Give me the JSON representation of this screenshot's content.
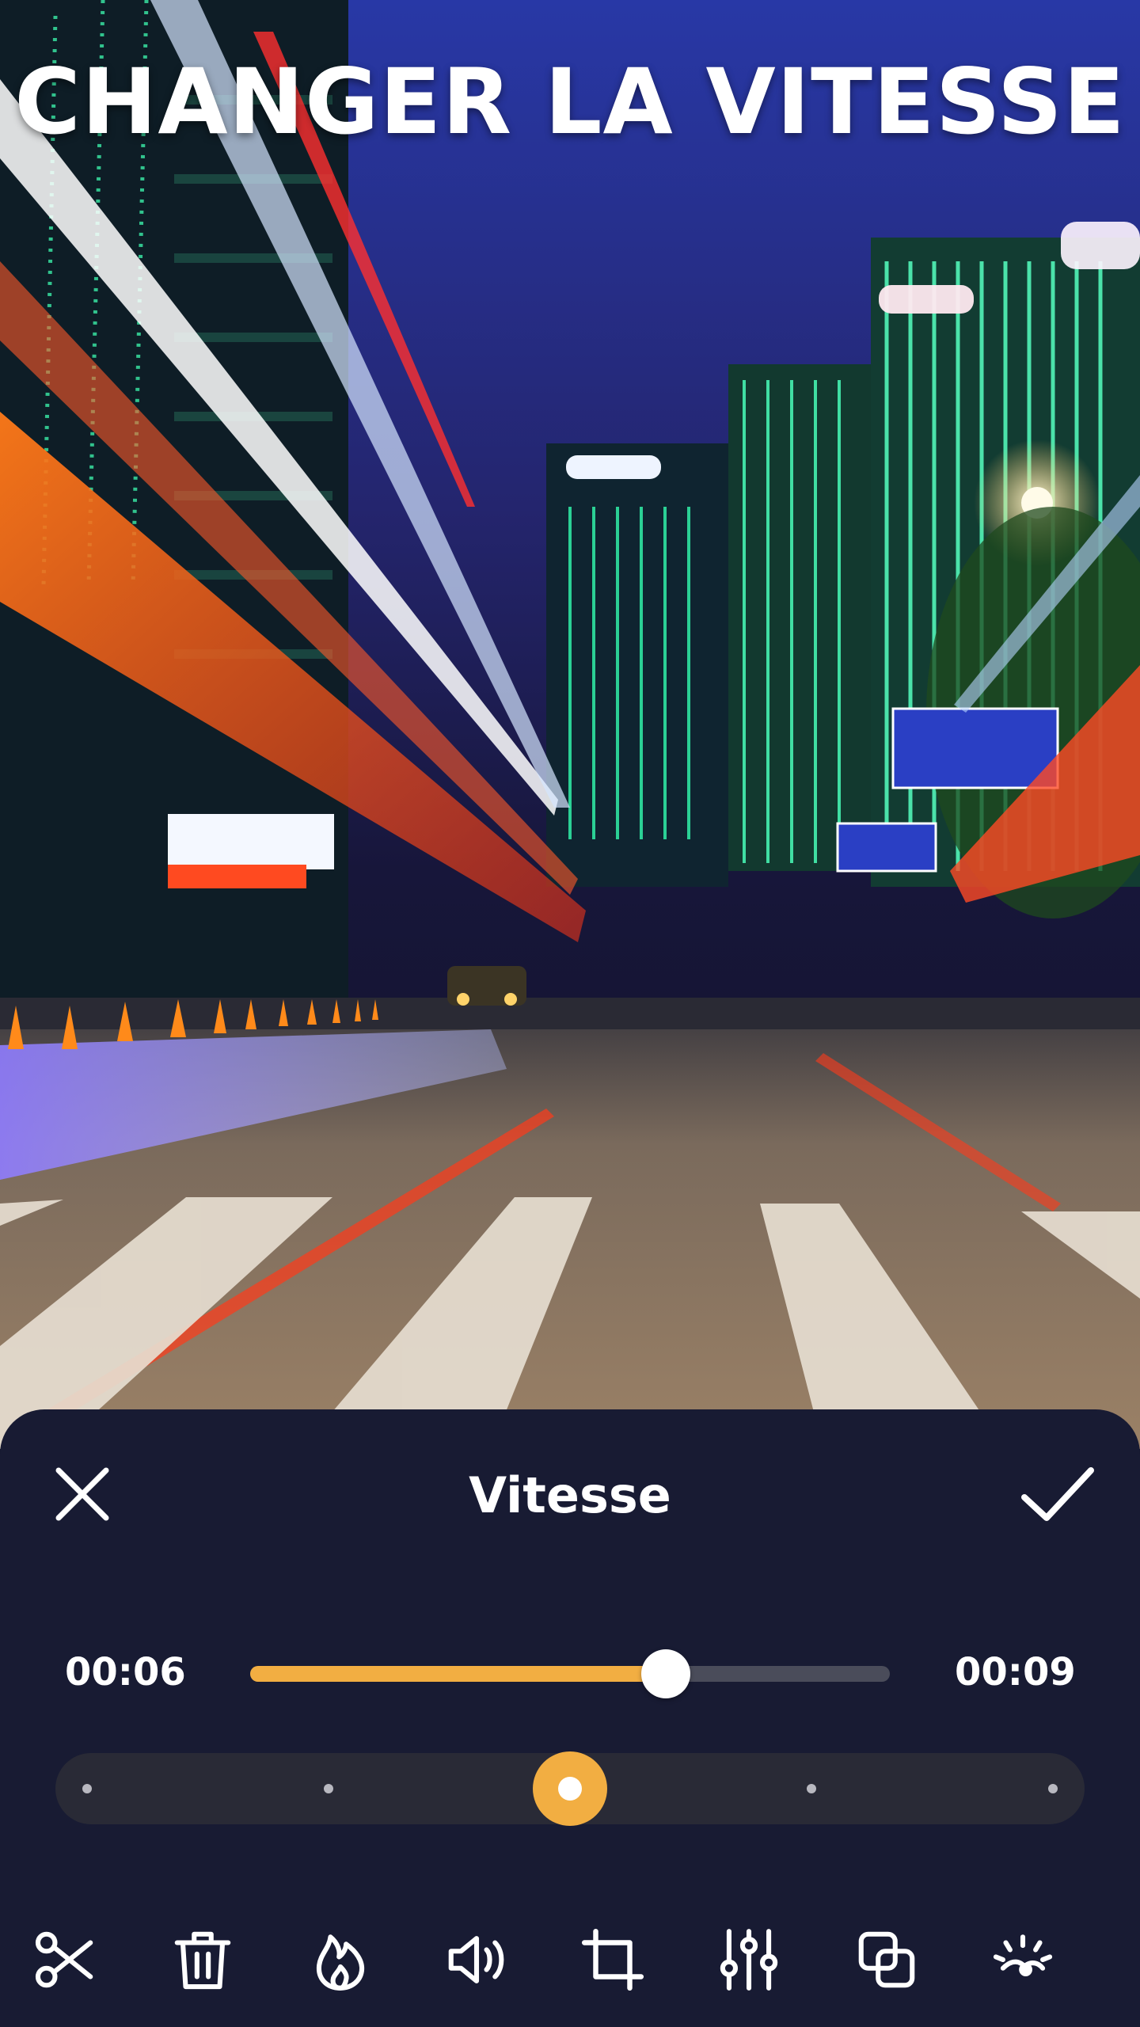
{
  "headline": "CHANGER LA VITESSE",
  "editor": {
    "title": "Vitesse",
    "close_icon": "close-icon",
    "confirm_icon": "check-icon",
    "current_time": "00:06",
    "total_time": "00:09",
    "progress_fraction": 0.65,
    "speed": {
      "stops": 5,
      "selected_index": 2
    },
    "tools": [
      {
        "icon": "scissors-icon"
      },
      {
        "icon": "trash-icon"
      },
      {
        "icon": "flame-icon"
      },
      {
        "icon": "volume-icon"
      },
      {
        "icon": "crop-icon"
      },
      {
        "icon": "sliders-icon"
      },
      {
        "icon": "overlay-icon"
      },
      {
        "icon": "sparkle-icon"
      }
    ]
  },
  "colors": {
    "accent": "#f2ae42",
    "sheet_background": "#181b33",
    "track": "#4a4c5a",
    "text": "#ffffff"
  }
}
